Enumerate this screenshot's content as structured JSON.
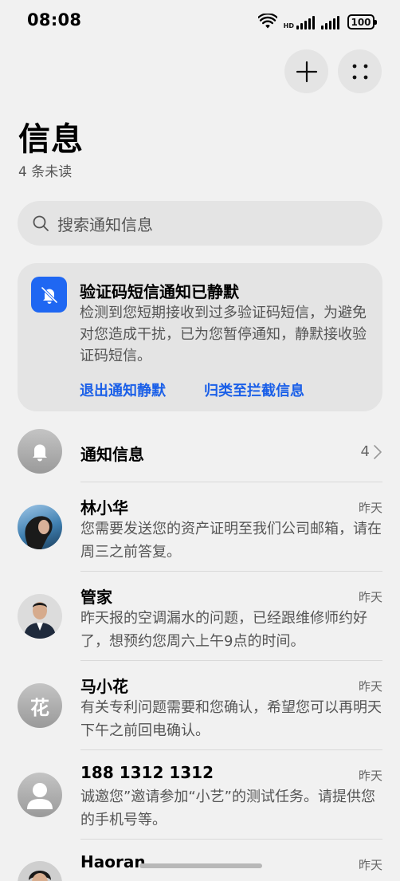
{
  "status": {
    "time": "08:08",
    "battery": "100",
    "signal_label": "HD"
  },
  "header": {
    "title": "信息",
    "unread": "4 条未读"
  },
  "search": {
    "placeholder": "搜索通知信息"
  },
  "notice": {
    "title": "验证码短信通知已静默",
    "body": "检测到您短期接收到过多验证码短信，为避免对您造成干扰，已为您暂停通知，静默接收验证码短信。",
    "action_exit": "退出通知静默",
    "action_block": "归类至拦截信息"
  },
  "notifications_row": {
    "name": "通知信息",
    "count": "4"
  },
  "conversations": [
    {
      "name": "林小华",
      "time": "昨天",
      "preview": "您需要发送您的资产证明至我们公司邮箱，请在周三之前答复。",
      "avatar": "photo-woman"
    },
    {
      "name": "管家",
      "time": "昨天",
      "preview": "昨天报的空调漏水的问题，已经跟维修师约好了，想预约您周六上午9点的时间。",
      "avatar": "photo-man-suit"
    },
    {
      "name": "马小花",
      "time": "昨天",
      "preview": "有关专利问题需要和您确认，希望您可以再明天下午之前回电确认。",
      "avatar": "花"
    },
    {
      "name": "188 1312 1312",
      "time": "昨天",
      "preview": "诚邀您”邀请参加“小艺”的测试任务。请提供您的手机号等。",
      "avatar": "person-placeholder"
    },
    {
      "name": "Haoran",
      "time": "昨天",
      "preview": "",
      "avatar": "photo-man"
    }
  ],
  "colors": {
    "accent": "#1a5fe8",
    "notice_icon_bg": "#1f67f2",
    "background": "#f1f1f1",
    "card": "#e4e4e4"
  }
}
